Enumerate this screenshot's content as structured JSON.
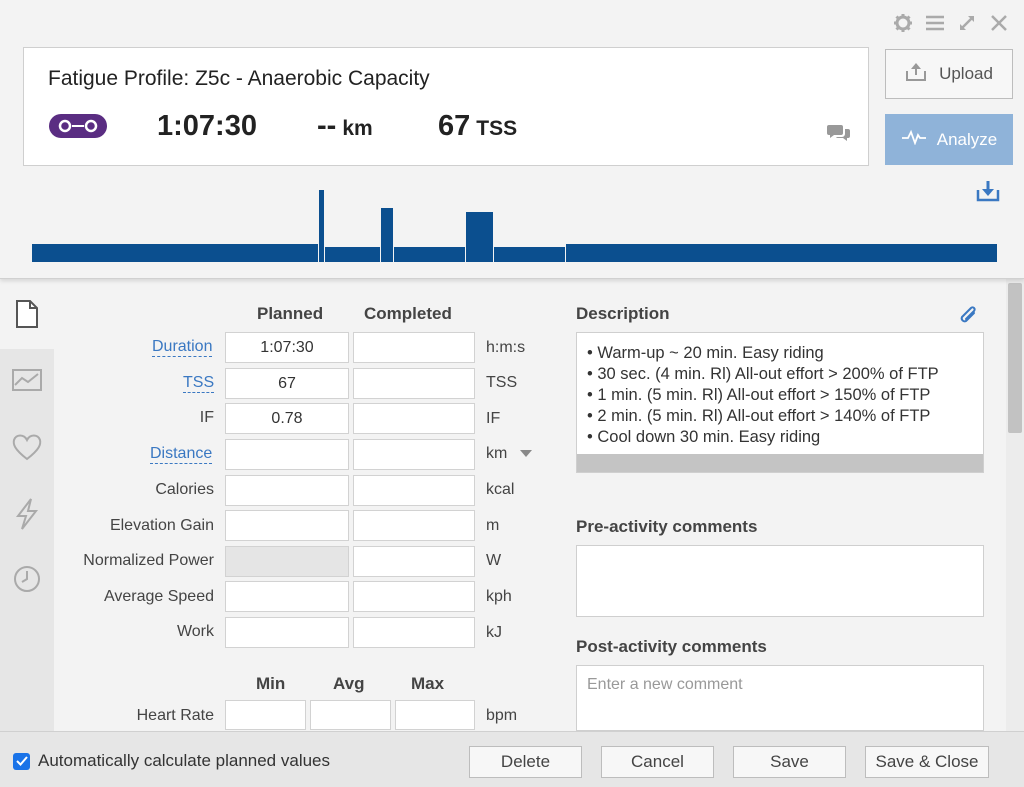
{
  "header": {
    "title": "Fatigue Profile: Z5c - Anaerobic Capacity",
    "duration": "1:07:30",
    "distance": "--",
    "distance_unit": "km",
    "tss": "67",
    "tss_unit": "TSS"
  },
  "actions": {
    "upload_label": "Upload",
    "analyze_label": "Analyze"
  },
  "colors": {
    "accent": "#3a78c2",
    "workout_bar": "#0b4f8f",
    "analyze_bg": "#8fb3d9",
    "bike_badge": "#5a2d82"
  },
  "form": {
    "col_planned": "Planned",
    "col_completed": "Completed",
    "rows": [
      {
        "label": "Duration",
        "planned": "1:07:30",
        "completed": "",
        "unit": "h:m:s"
      },
      {
        "label": "TSS",
        "planned": "67",
        "completed": "",
        "unit": "TSS"
      },
      {
        "label": "IF",
        "planned": "0.78",
        "completed": "",
        "unit": "IF"
      },
      {
        "label": "Distance",
        "planned": "",
        "completed": "",
        "unit": "km"
      },
      {
        "label": "Calories",
        "planned": "",
        "completed": "",
        "unit": "kcal"
      },
      {
        "label": "Elevation Gain",
        "planned": "",
        "completed": "",
        "unit": "m"
      },
      {
        "label": "Normalized Power",
        "planned": "",
        "completed": "",
        "unit": "W"
      },
      {
        "label": "Average Speed",
        "planned": "",
        "completed": "",
        "unit": "kph"
      },
      {
        "label": "Work",
        "planned": "",
        "completed": "",
        "unit": "kJ"
      }
    ],
    "col_min": "Min",
    "col_avg": "Avg",
    "col_max": "Max",
    "hr_label": "Heart Rate",
    "hr_unit": "bpm"
  },
  "description": {
    "heading": "Description",
    "items": [
      "Warm-up ~ 20 min. Easy riding",
      "30 sec. (4 min. Rl) All-out effort > 200% of FTP",
      "1 min. (5 min. Rl) All-out effort > 150% of FTP",
      "2 min. (5 min. Rl) All-out effort > 140% of FTP",
      "Cool down 30 min. Easy riding"
    ]
  },
  "comments": {
    "pre_heading": "Pre-activity comments",
    "post_heading": "Post-activity comments",
    "post_placeholder": "Enter a new comment"
  },
  "footer": {
    "auto_calc_label": "Automatically calculate planned values",
    "auto_calc_checked": true,
    "delete_label": "Delete",
    "cancel_label": "Cancel",
    "save_label": "Save",
    "save_close_label": "Save & Close"
  },
  "workout_profile": {
    "intensity_unit": "% of FTP",
    "segments": [
      {
        "label": "Warm-up",
        "intensity": 50
      },
      {
        "label": "All-out",
        "intensity": 200
      },
      {
        "label": "Recovery",
        "intensity": 42
      },
      {
        "label": "All-out",
        "intensity": 150
      },
      {
        "label": "Recovery",
        "intensity": 42
      },
      {
        "label": "All-out",
        "intensity": 140
      },
      {
        "label": "Recovery",
        "intensity": 42
      },
      {
        "label": "Cool down",
        "intensity": 50
      }
    ]
  }
}
